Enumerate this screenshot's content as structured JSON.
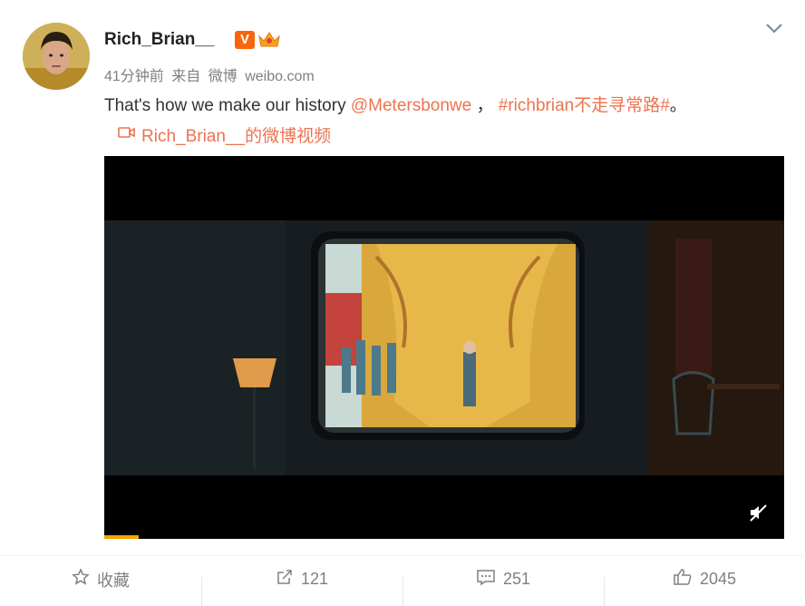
{
  "post": {
    "username": "Rich_Brian__",
    "verified_badge": "V",
    "meta": {
      "time": "41分钟前",
      "source_prefix": "来自",
      "source_app": "微博",
      "source_site": "weibo.com"
    },
    "text": {
      "body": "That's how we make our history ",
      "mention": "@Metersbonwe",
      "separator": " ，",
      "hashtag": "#richbrian不走寻常路#",
      "end": "。"
    },
    "video_link": "Rich_Brian__的微博视频",
    "video": {
      "progress": 0.05
    }
  },
  "footer": {
    "favorite_label": "收藏",
    "repost_count": "121",
    "comment_count": "251",
    "like_count": "2045"
  },
  "colors": {
    "link": "#eb7350",
    "meta": "#808080",
    "progress": "#f7a200",
    "badge": "#f8650c"
  }
}
